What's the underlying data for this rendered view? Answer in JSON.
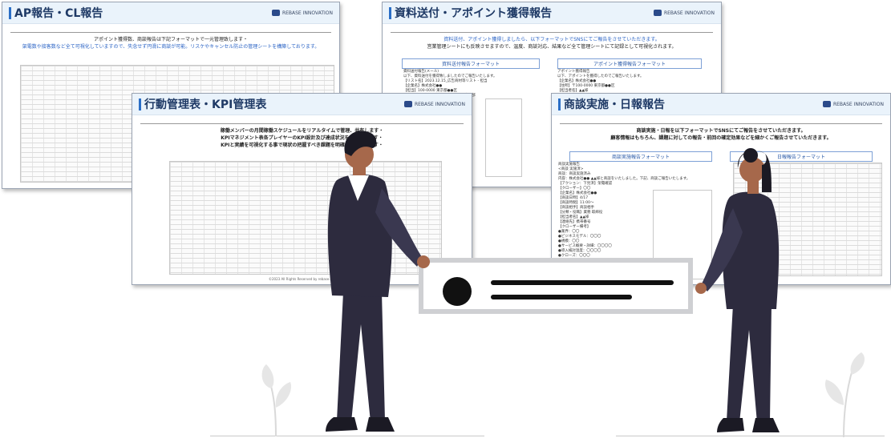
{
  "cards": {
    "ap": {
      "title": "AP報告・CL報告",
      "brand": "REBASE INNOVATION",
      "desc_line1": "アポイント獲得数、商談報告は下記フォーマットで一元管理致します・",
      "desc_line2_blue": "架電数や接客数など全て可視化していますので、失念せず円滑に商談が可能。リスケやキャンセル防止の管理シートを構築しております。"
    },
    "material": {
      "title": "資料送付・アポイント獲得報告",
      "brand": "REBASE INNOVATION",
      "desc_line1_blue": "資料送付、アポイント獲得しましたら、以下フォーマットでSNSにてご報告をさせていただきます。",
      "desc_line2": "営業管理シートにも反映させますので、温度、商談対応、結果など全て管理シートにて記録として可視化されます。",
      "section_left": "資料送付報告フォーマット",
      "section_right": "アポイント獲得報告フォーマット",
      "left_text": "資料送付報告(メール)\n以下、資料送付を獲得致しましたのでご報告いたします。\n【リスト名】2023.12.15_広告商材等リスト - 担当\n【企業名】株式会社●●\n【担当】100-0000 東京都●●区\n【商材】代表オフイスソリューション事業部",
      "right_text": "アポイント獲得報告\n以下、アポイントを獲得したのでご報告いたします。\n【企業名】株式会社●●\n【住所】〒100-0000 東京都●●区\n【担当者名】▲▲様\n【TEL】03-1234-5678"
    },
    "kpi": {
      "title": "行動管理表・KPI管理表",
      "brand": "REBASE INNOVATION",
      "desc_line1": "稼働メンバーの月間稼働スケジュールをリアルタイムで管理、共有します・",
      "desc_line2": "KPIマネジメント表各プレイヤーのKPI設計及び達成状況を可視化します・",
      "desc_line3": "KPIと実績を可視化する事で現状の把握すべき課題を明確にし改善します・",
      "footer": "©2023 All Rights Reserved by rebase.innovation"
    },
    "daily": {
      "title": "商談実施・日報報告",
      "brand": "REBASE INNOVATION",
      "desc_line1": "商談実施・日報を以下フォーマットでSNSにてご報告をさせていただきます。",
      "desc_line2": "顧客情報はもちろん、課題に対しての報告・前回の確定効果などを細かくご報告させていただきます。",
      "section_left": "商談実施報告フォーマット",
      "section_right": "日報報告フォーマット",
      "left_text": "商談実施報告\n<商談 実施済>\n商談：商談実施済み\n内容：株式会社●● ▲▲様と商談をいたしました。下記、商談ご報告いたします。\n【アクション：下見済】架電確認\n【クローザー】〇〇\n【企業名】株式会社●●\n【商談日時】4/17\n【商談時間】11:00～\n【商談相手】商談相手\n【分類・役職】業務 取締役\n【担当者名】▲▲様\n【連絡先】携帯番号",
      "left_text2": "【クローザー備考】\n●業界：〇〇\n●ビジネスモデル：〇〇〇\n●規模：〇〇\n●サービス概要・詳細：〇〇〇〇\n●導入検討温度：〇〇〇〇\n●クローズ：〇〇〇\n●所感等：〇〇〇"
    }
  },
  "message_card": {
    "icon": "avatar-dot-icon"
  },
  "colors": {
    "accent": "#2a6ec6",
    "title": "#1f3a66",
    "figure_dark": "#2d2b3e",
    "skin": "#a6684b",
    "hair": "#1b1a24"
  }
}
